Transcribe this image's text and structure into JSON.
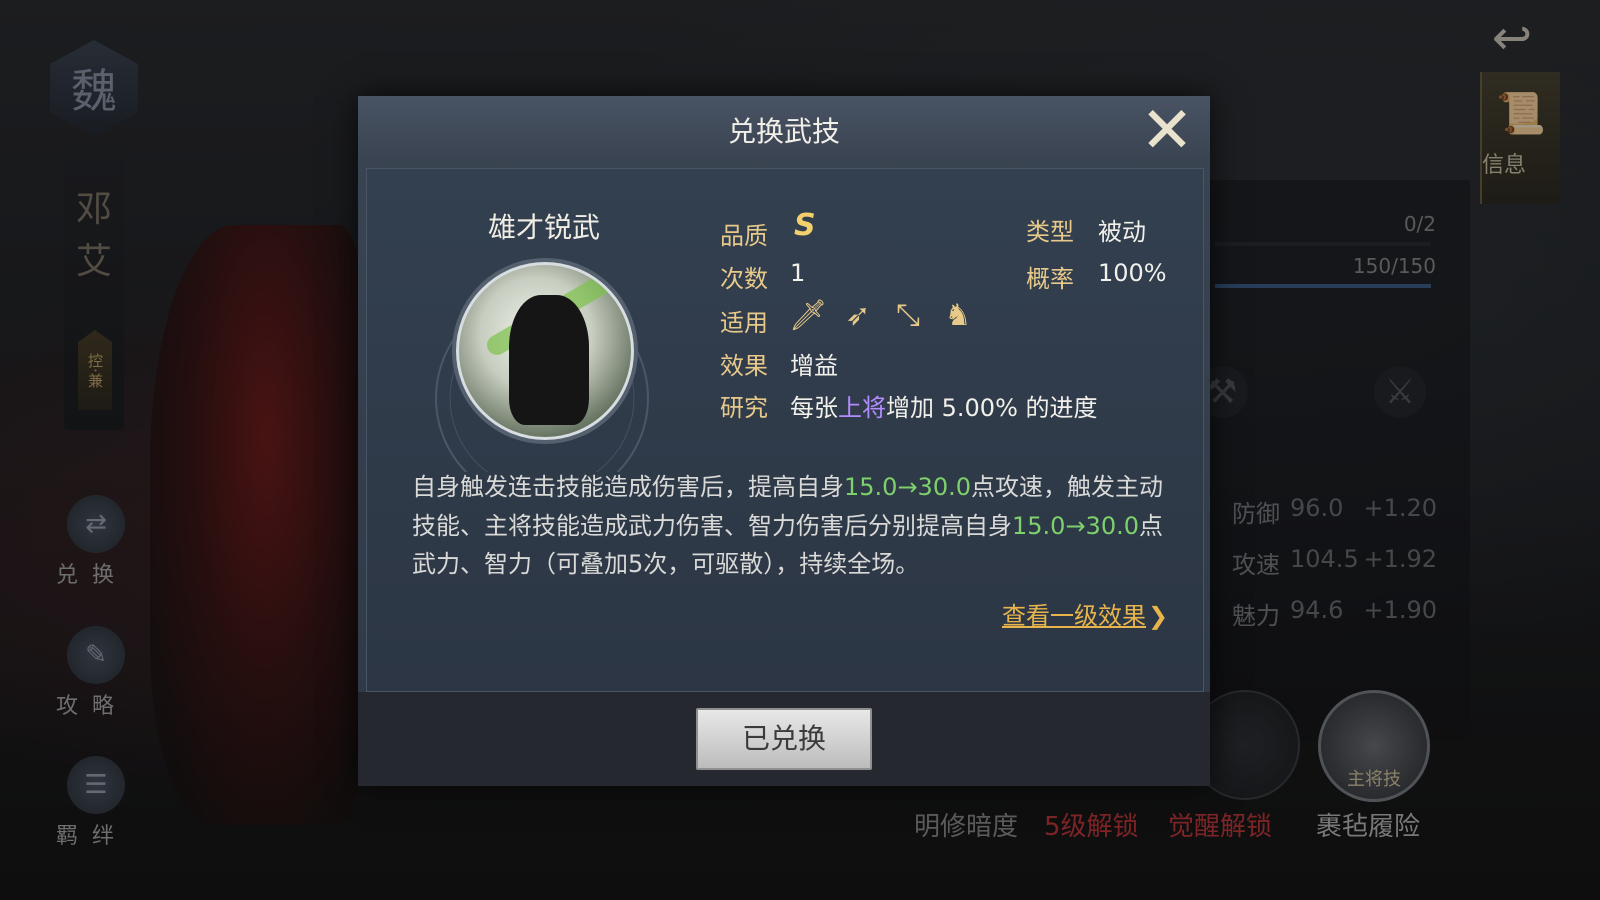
{
  "background": {
    "faction_char": "魏",
    "general_name_chars": [
      "邓",
      "艾"
    ],
    "role_tag": "控·兼",
    "side_buttons": [
      {
        "label": "兑换",
        "icon": "exchange-icon"
      },
      {
        "label": "攻略",
        "icon": "scroll-icon"
      },
      {
        "label": "羁绊",
        "icon": "bond-icon"
      }
    ],
    "info_tab_label": "信息",
    "top_stats": [
      "0/2",
      "150/150"
    ],
    "attributes": [
      {
        "name": "防御",
        "value": "96.0",
        "plus": "+1.20"
      },
      {
        "name": "攻速",
        "value": "104.5",
        "plus": "+1.92"
      },
      {
        "name": "魅力",
        "value": "94.6",
        "plus": "+1.90"
      }
    ],
    "bottom_skills": [
      {
        "label": "明修暗度",
        "color": "#8d8d8d"
      },
      {
        "label": "5级解锁",
        "color": "#c0393b"
      },
      {
        "label": "觉醒解锁",
        "color": "#c0393b"
      },
      {
        "label": "裹毡履险",
        "color": "#b9b9b9"
      }
    ],
    "main_skill_badge": "主将技"
  },
  "modal": {
    "title": "兑换武技",
    "skill_name": "雄才锐武",
    "labels": {
      "quality": "品质",
      "count": "次数",
      "applicable": "适用",
      "effect": "效果",
      "research": "研究",
      "type": "类型",
      "rate": "概率"
    },
    "quality_value": "S",
    "count_value": "1",
    "effect_value": "增益",
    "type_value": "被动",
    "rate_value": "100%",
    "applicable_icons": [
      "sword-icon",
      "bow-icon",
      "spear-icon",
      "horse-icon"
    ],
    "research": {
      "prefix": "每张",
      "highlight": "上将",
      "suffix": "增加 5.00% 的进度"
    },
    "description": {
      "part1": "自身触发连击技能造成伤害后，提高自身",
      "num1": "15.0→30.0",
      "part2": "点攻速，触发主动技能、主将技能造成武力伤害、智力伤害后分别提高自身",
      "num2": "15.0→30.0",
      "part3": "点武力、智力（可叠加5次，可驱散），持续全场。"
    },
    "link_text": "查看一级效果",
    "link_arrow": "❯",
    "button_label": "已兑换",
    "colors": {
      "accent_gold": "#e7c98a",
      "highlight_purple": "#b38cff",
      "value_green": "#7ed06b",
      "link": "#e8b54c"
    }
  }
}
